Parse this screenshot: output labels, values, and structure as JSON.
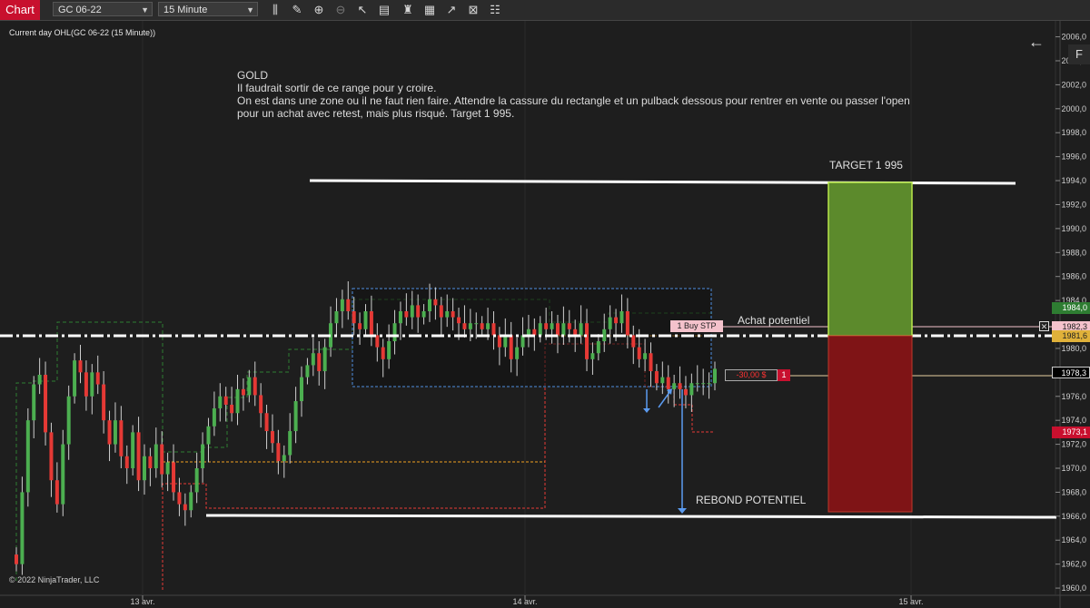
{
  "toolbar": {
    "chart_tab": "Chart",
    "instrument": "GC 06-22",
    "interval": "15 Minute",
    "tools": [
      "bars-icon",
      "pencil-icon",
      "zoom-in-icon",
      "zoom-out-icon",
      "pointer-icon",
      "data-box-icon",
      "strategy-icon",
      "indicator-icon",
      "drawing-tools-icon",
      "properties-icon",
      "template-icon"
    ]
  },
  "chart": {
    "series_title": "Current day OHL(GC 06-22 (15 Minute))",
    "copyright": "© 2022 NinjaTrader, LLC",
    "f_button": "F",
    "note": {
      "title": "GOLD",
      "lines": [
        "Il faudrait sortir de ce range pour y croire.",
        "On est dans une zone ou il ne faut rien faire. Attendre la cassure du rectangle et un pulback dessous pour rentrer en vente ou passer l'open",
        "pour un achat avec retest, mais plus risqué. Target 1 995."
      ]
    },
    "annotations": {
      "target": "TARGET 1 995",
      "achat": "Achat potentiel",
      "rebond": "REBOND POTENTIEL"
    },
    "order": {
      "label": "1  Buy STP",
      "pnl": "-30,00 $",
      "qty": "1"
    },
    "price_badges": {
      "green": "1984,0",
      "order": "1982,3",
      "yellow": "1981,6",
      "last": "1978,3",
      "red": "1973,1"
    },
    "colors": {
      "bull": "#4caf50",
      "bear": "#e53935",
      "target_zone": "#5c8a2c",
      "stop_zone": "#7f1416",
      "rectangle": "#4f8fe0"
    }
  },
  "chart_data": {
    "type": "candlestick",
    "yticks": [
      1960,
      1962,
      1964,
      1966,
      1968,
      1970,
      1972,
      1974,
      1976,
      1978,
      1980,
      1982,
      1984,
      1986,
      1988,
      1990,
      1992,
      1994,
      1996,
      1998,
      2000,
      2002,
      2004,
      2006
    ],
    "ytick_labels": [
      "1960,0",
      "1962,0",
      "1964,0",
      "1966,0",
      "1968,0",
      "1970,0",
      "1972,0",
      "1974,0",
      "1976,0",
      "1978,0",
      "1980,0",
      "1982,0",
      "1984,0",
      "1986,0",
      "1988,0",
      "1990,0",
      "1992,0",
      "1994,0",
      "1996,0",
      "1998,0",
      "2000,0",
      "2002,0",
      "2004,0",
      "2006,0"
    ],
    "xtick_labels": [
      "13 avr.",
      "14 avr.",
      "15 avr."
    ],
    "ylim": [
      1959.4,
      2006.8
    ],
    "levels": {
      "target": 1995,
      "entry": 1982.3,
      "entry_dash": 1981.6,
      "last": 1978.3,
      "support": 1966,
      "rect_top": 1986,
      "rect_bottom": 1977.2
    },
    "closes": [
      1962,
      1968,
      1974,
      1977,
      1977.8,
      1973,
      1969,
      1967,
      1972,
      1976,
      1979,
      1978,
      1976,
      1978,
      1977,
      1974,
      1972,
      1974,
      1971,
      1970,
      1973,
      1969,
      1971,
      1970,
      1972,
      1969.5,
      1970.5,
      1968,
      1967,
      1966.5,
      1968,
      1970,
      1972,
      1973.5,
      1975,
      1976,
      1975.3,
      1974.6,
      1976.6,
      1976.1,
      1977.6,
      1976.1,
      1974.6,
      1973.1,
      1972.1,
      1970.6,
      1971.1,
      1973.1,
      1975.6,
      1977.6,
      1978.6,
      1979.6,
      1978.1,
      1980.1,
      1982.1,
      1983.1,
      1984.1,
      1983.1,
      1982.1,
      1981.6,
      1983.1,
      1981.1,
      1980.1,
      1979.1,
      1980.6,
      1982.1,
      1983.1,
      1982.6,
      1983.6,
      1982.6,
      1983.1,
      1984.1,
      1983.6,
      1982.6,
      1983.1,
      1982.6,
      1982.1,
      1981.6,
      1982.1,
      1982.1,
      1981.6,
      1982.1,
      1981.1,
      1980.1,
      1981.1,
      1979.1,
      1980.1,
      1981.1,
      1981.6,
      1981.1,
      1982.1,
      1981.6,
      1982.1,
      1981.1,
      1982.1,
      1981.6,
      1981.1,
      1982.1,
      1979.1,
      1979.6,
      1980.6,
      1981.6,
      1982.6,
      1982.1,
      1983.1,
      1981.1,
      1980.1,
      1979.1,
      1979.6,
      1978.1,
      1977.1,
      1977.6,
      1976.6,
      1977.1,
      1976.6,
      1976.1,
      1977.1,
      1977.1,
      1977.1,
      1977.1,
      1978.3
    ],
    "xlim_days": [
      "13 avr.",
      "14 avr.",
      "15 avr."
    ]
  }
}
